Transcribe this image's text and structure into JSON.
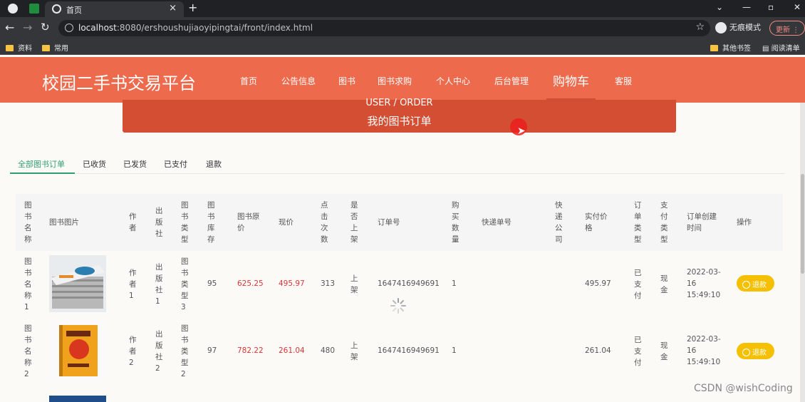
{
  "browser": {
    "tab_title": "首页",
    "url_host": "localhost",
    "url_path": ":8080/ershoushujiaoyipingtai/front/index.html",
    "incognito_label": "无痕模式",
    "update_label": "更新",
    "bookmarks": [
      "资料",
      "常用"
    ],
    "bookmarks_right": [
      "其他书签",
      "阅读清单"
    ]
  },
  "header": {
    "logo": "校园二手书交易平台",
    "menu": [
      "首页",
      "公告信息",
      "图书",
      "图书求购",
      "个人中心",
      "后台管理",
      "购物车",
      "客服"
    ],
    "active": "购物车"
  },
  "banner": {
    "en": "USER / ORDER",
    "cn": "我的图书订单"
  },
  "order_tabs": [
    "全部图书订单",
    "已收货",
    "已发货",
    "已支付",
    "退款"
  ],
  "table": {
    "headers": [
      "图书名称",
      "图书图片",
      "作者",
      "出版社",
      "图书类型",
      "图书库存",
      "图书原价",
      "现价",
      "点击次数",
      "是否上架",
      "订单号",
      "购买数量",
      "快递单号",
      "快递公司",
      "实付价格",
      "订单类型",
      "支付类型",
      "订单创建时间",
      "操作"
    ],
    "rows": [
      {
        "name": "图书名称1",
        "author": "作者1",
        "publisher": "出版社1",
        "type": "图书类型3",
        "stock": "95",
        "orig": "625.25",
        "price": "495.97",
        "clicks": "313",
        "shelf": "上架",
        "order_no": "1647416949691",
        "qty": "1",
        "express_no": "",
        "company": "",
        "paid": "495.97",
        "order_type": "已支付",
        "pay_type": "现金",
        "created": "2022-03-16 15:49:10",
        "action": "退款"
      },
      {
        "name": "图书名称2",
        "author": "作者2",
        "publisher": "出版社2",
        "type": "图书类型2",
        "stock": "97",
        "orig": "782.22",
        "price": "261.04",
        "clicks": "480",
        "shelf": "上架",
        "order_no": "1647416949691",
        "qty": "1",
        "express_no": "",
        "company": "",
        "paid": "261.04",
        "order_type": "已支付",
        "pay_type": "现金",
        "created": "2022-03-16 15:49:10",
        "action": "退款"
      }
    ]
  },
  "watermark": "CSDN @wishCoding",
  "colors": {
    "header": "#ee6a4d",
    "banner": "#d34e32",
    "accent": "#2f9e73",
    "price": "#d93636",
    "button": "#f5c000"
  }
}
